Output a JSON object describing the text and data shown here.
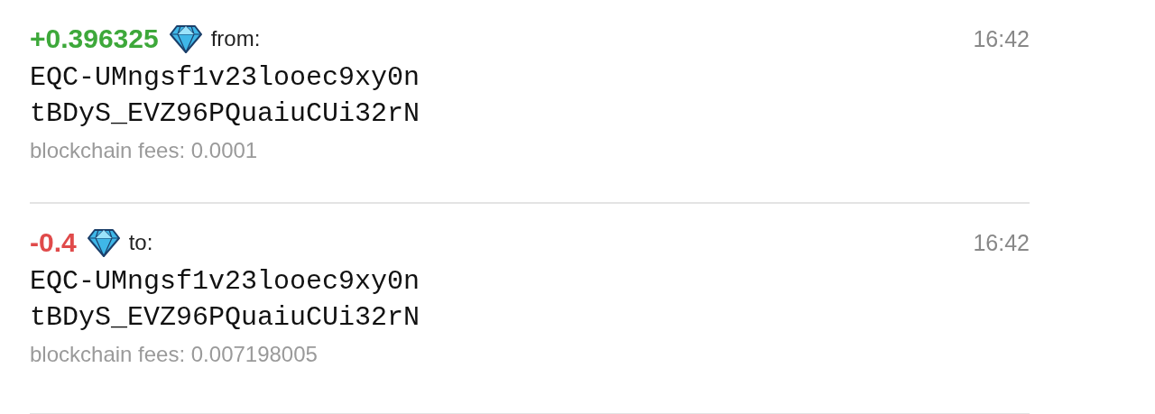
{
  "transactions": [
    {
      "kind": "incoming",
      "amount": "+0.396325",
      "label": "from:",
      "time": "16:42",
      "address": [
        "EQC-UMngsf1v23looec9xy0n",
        "tBDyS_EVZ96PQuaiuCUi32rN"
      ],
      "fees": "blockchain fees: 0.0001"
    },
    {
      "kind": "outgoing",
      "amount": "-0.4",
      "label": "to:",
      "time": "16:42",
      "address": [
        "EQC-UMngsf1v23looec9xy0n",
        "tBDyS_EVZ96PQuaiuCUi32rN"
      ],
      "fees": "blockchain fees: 0.007198005"
    }
  ]
}
